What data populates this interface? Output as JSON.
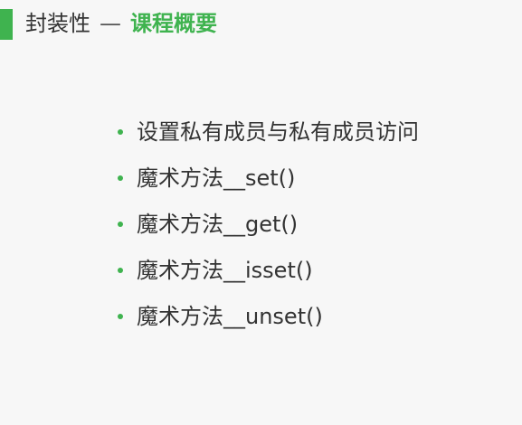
{
  "header": {
    "title": "封装性",
    "separator": "—",
    "subtitle": "课程概要"
  },
  "bullets": [
    "设置私有成员与私有成员访问",
    "魔术方法__set()",
    "魔术方法__get()",
    "魔术方法__isset()",
    "魔术方法__unset()"
  ],
  "colors": {
    "accent": "#3fb34f",
    "background": "#f7f7f7",
    "text": "#333333"
  }
}
